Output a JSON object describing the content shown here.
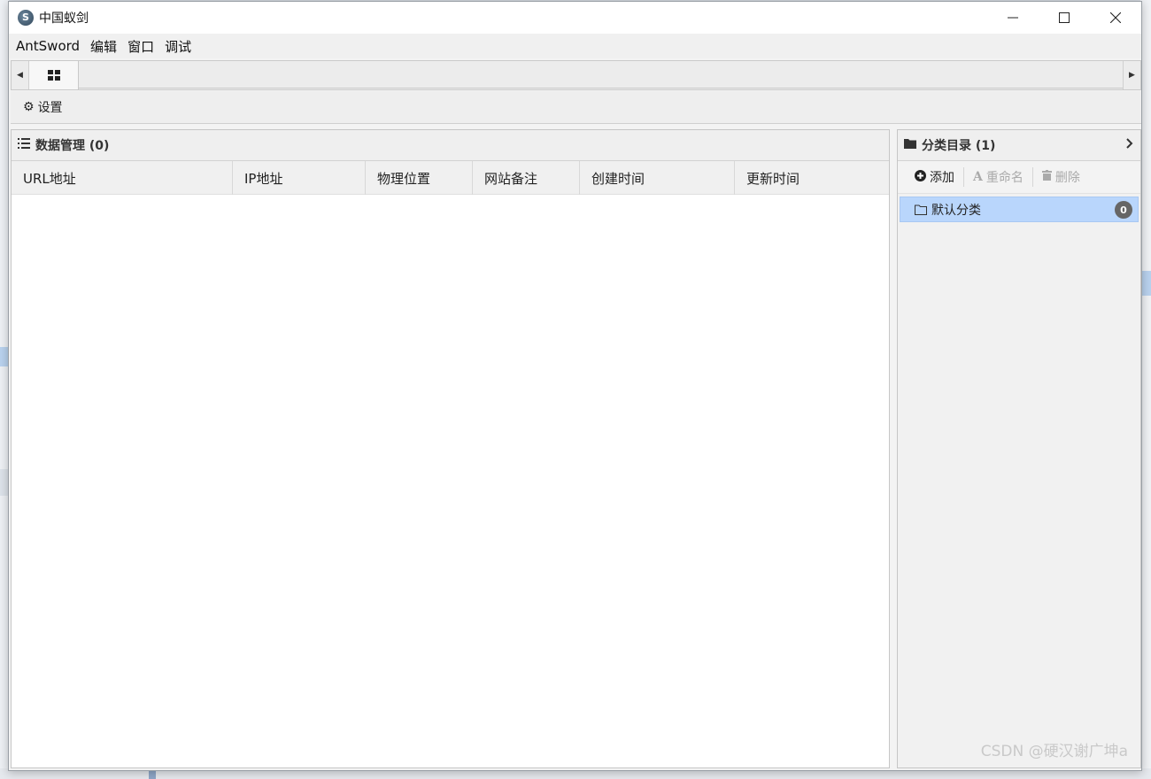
{
  "window": {
    "title": "中国蚁剑",
    "app_icon_glyph": "S"
  },
  "menu": {
    "items": [
      "AntSword",
      "编辑",
      "窗口",
      "调试"
    ]
  },
  "tabbar": {
    "left_arrow": "◀",
    "right_arrow": "▶",
    "home_tab_icon": "grid-icon"
  },
  "toolbar": {
    "settings_label": "设置",
    "settings_icon": "gear-icon"
  },
  "data_panel": {
    "title": "数据管理 (0)",
    "columns": [
      "URL地址",
      "IP地址",
      "物理位置",
      "网站备注",
      "创建时间",
      "更新时间"
    ],
    "rows": []
  },
  "category_panel": {
    "title": "分类目录 (1)",
    "collapse_glyph": "›",
    "add_label": "添加",
    "rename_label": "重命名",
    "delete_label": "删除",
    "items": [
      {
        "name": "默认分类",
        "count": "0",
        "selected": true
      }
    ]
  },
  "watermark": "CSDN @硬汉谢广坤a",
  "colors": {
    "selection": "#b9d6fc",
    "badge": "#666666",
    "panel_header": "#efefef"
  }
}
